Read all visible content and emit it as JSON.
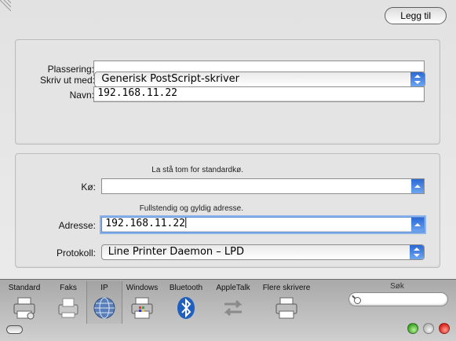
{
  "toolbar": {
    "items": [
      {
        "id": "standard",
        "label": "Standard",
        "icon": "printer-icon"
      },
      {
        "id": "fax",
        "label": "Faks",
        "icon": "fax-icon"
      },
      {
        "id": "ip",
        "label": "IP",
        "icon": "globe-icon",
        "selected": true
      },
      {
        "id": "windows",
        "label": "Windows",
        "icon": "windows-printer-icon"
      },
      {
        "id": "bluetooth",
        "label": "Bluetooth",
        "icon": "bluetooth-icon"
      },
      {
        "id": "appletalk",
        "label": "AppleTalk",
        "icon": "appletalk-icon"
      },
      {
        "id": "more",
        "label": "Flere skrivere",
        "icon": "printer-icon"
      }
    ],
    "search": {
      "label": "Søk",
      "value": ""
    }
  },
  "connection": {
    "protocol": {
      "label": "Protokoll:",
      "value": "Line Printer Daemon – LPD"
    },
    "address": {
      "label": "Adresse:",
      "value": "192.168.11.22",
      "hint": "Fullstendig og gyldig adresse."
    },
    "queue": {
      "label": "Kø:",
      "value": "",
      "hint": "La stå tom for standardkø."
    }
  },
  "printer": {
    "name": {
      "label": "Navn:",
      "value": "192.168.11.22"
    },
    "location": {
      "label": "Plassering:",
      "value": ""
    },
    "print_using": {
      "label": "Skriv ut med:",
      "value": "Generisk PostScript-skriver"
    }
  },
  "actions": {
    "add_label": "Legg til"
  },
  "colors": {
    "accent": "#3b78dc",
    "close": "#d8231a",
    "zoom": "#3aa222"
  }
}
